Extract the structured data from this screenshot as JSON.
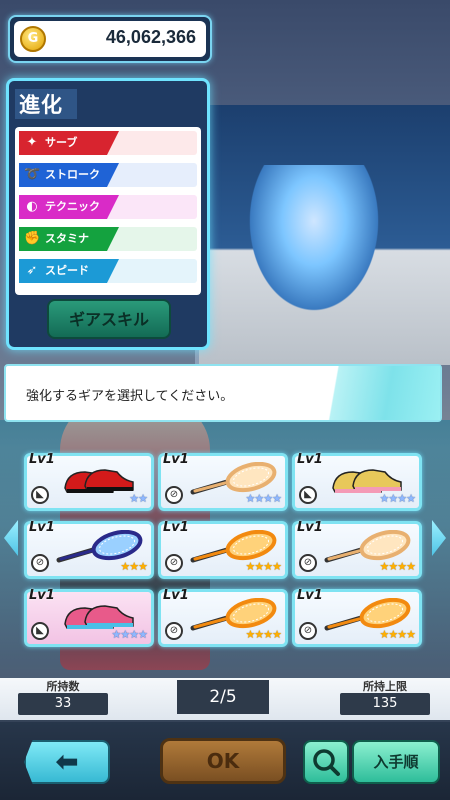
{
  "coins": {
    "icon": "G",
    "value": "46,062,366"
  },
  "evolution": {
    "title": "進化",
    "stats": [
      {
        "label": "サーブ",
        "icon": "serve-icon",
        "color": "#d8242f",
        "row_color": "#fde9ea",
        "glyph": "✦"
      },
      {
        "label": "ストローク",
        "icon": "stroke-icon",
        "color": "#1f63d6",
        "row_color": "#e6eefc",
        "glyph": "➰"
      },
      {
        "label": "テクニック",
        "icon": "technique-icon",
        "color": "#d92bc7",
        "row_color": "#fbe6f8",
        "glyph": "◐"
      },
      {
        "label": "スタミナ",
        "icon": "stamina-icon",
        "color": "#14a23f",
        "row_color": "#e5f6ea",
        "glyph": "✊"
      },
      {
        "label": "スピード",
        "icon": "speed-icon",
        "color": "#1c9ad6",
        "row_color": "#e4f4fb",
        "glyph": "➶"
      }
    ],
    "gear_skill_label": "ギアスキル"
  },
  "message": "強化するギアを選択してください。",
  "gear": [
    {
      "level": "Lv1",
      "type": "shoes",
      "stars": "★★",
      "star_color": "blue",
      "highlight": false
    },
    {
      "level": "Lv1",
      "type": "racket",
      "stars": "★★★★",
      "star_color": "blue",
      "highlight": false
    },
    {
      "level": "Lv1",
      "type": "shoes",
      "stars": "★★★★",
      "star_color": "blue",
      "highlight": false
    },
    {
      "level": "Lv1",
      "type": "racket",
      "stars": "★★★",
      "star_color": "gold",
      "highlight": false
    },
    {
      "level": "Lv1",
      "type": "racket",
      "stars": "★★★★",
      "star_color": "gold",
      "highlight": false
    },
    {
      "level": "Lv1",
      "type": "racket",
      "stars": "★★★★",
      "star_color": "gold",
      "highlight": false
    },
    {
      "level": "Lv1",
      "type": "shoes",
      "stars": "★★★★",
      "star_color": "blue",
      "highlight": true
    },
    {
      "level": "Lv1",
      "type": "racket",
      "stars": "★★★★",
      "star_color": "gold",
      "highlight": false
    },
    {
      "level": "Lv1",
      "type": "racket",
      "stars": "★★★★",
      "star_color": "gold",
      "highlight": false
    }
  ],
  "counters": {
    "owned_label": "所持数",
    "owned_value": "33",
    "page": "2/5",
    "limit_label": "所持上限",
    "limit_value": "135"
  },
  "buttons": {
    "back": "⬅",
    "ok": "OK",
    "sort": "入手順"
  }
}
